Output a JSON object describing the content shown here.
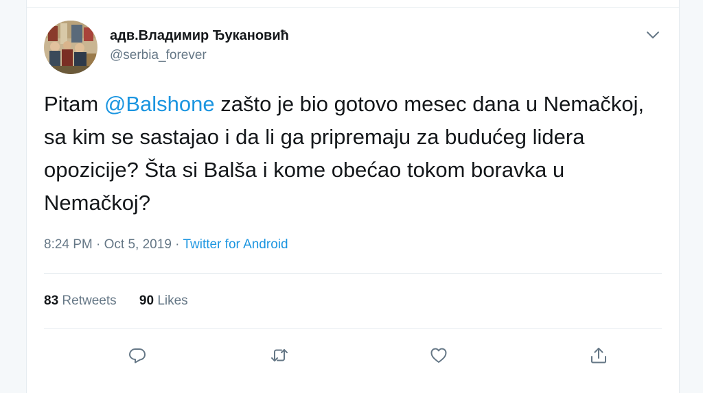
{
  "author": {
    "display_name": "адв.Владимир Ђукановић",
    "handle": "@serbia_forever",
    "avatar_icon": "painting-avatar"
  },
  "tweet": {
    "text_before": "Pitam ",
    "mention": "@Balshone",
    "text_after": " zašto je bio gotovo mesec dana u Nemačkoj, sa kim se sastajao i da li ga pripremaju za budućeg lidera opozicije? Šta si Balša i kome obećao tokom boravka u Nemačkoj?"
  },
  "meta": {
    "time": "8:24 PM",
    "separator1": " · ",
    "date": "Oct 5, 2019",
    "separator2": " · ",
    "source": "Twitter for Android"
  },
  "stats": {
    "retweets_count": "83",
    "retweets_label": " Retweets",
    "likes_count": "90",
    "likes_label": " Likes"
  },
  "actions": {
    "icons": [
      "reply-icon",
      "retweet-icon",
      "like-icon",
      "share-icon"
    ]
  },
  "colors": {
    "link": "#1b95e0",
    "secondary_text": "#657786",
    "divider": "#e6ecf0"
  }
}
